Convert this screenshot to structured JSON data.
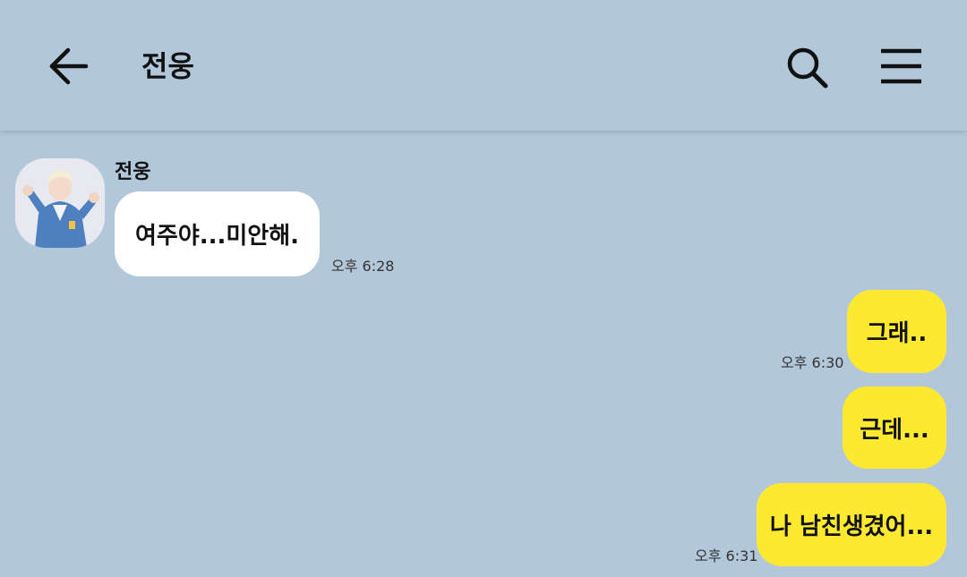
{
  "header": {
    "back_icon": "arrow-left-icon",
    "title": "전웅",
    "search_icon": "search-icon",
    "menu_icon": "hamburger-menu-icon"
  },
  "colors": {
    "background": "#b2c7da",
    "incoming_bubble": "#ffffff",
    "outgoing_bubble": "#fee931"
  },
  "messages": [
    {
      "direction": "incoming",
      "sender": "전웅",
      "text": "여주야...미안해.",
      "time": "오후 6:28"
    },
    {
      "direction": "outgoing",
      "text": "그래..",
      "time": "오후 6:30"
    },
    {
      "direction": "outgoing",
      "text": "근데...",
      "time": ""
    },
    {
      "direction": "outgoing",
      "text": "나 남친생겼어...",
      "time": "오후 6:31"
    }
  ]
}
